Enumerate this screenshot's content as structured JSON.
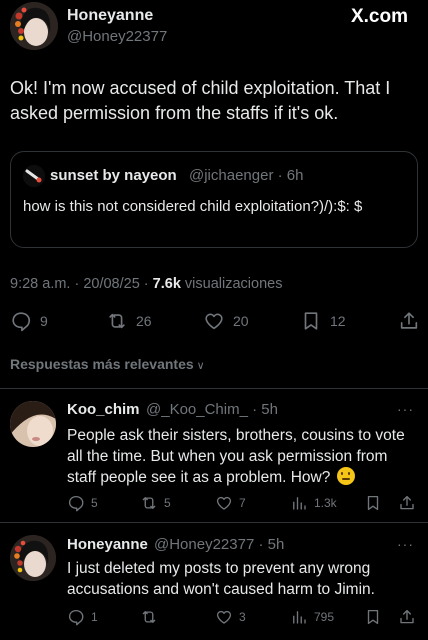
{
  "header": {
    "author_name": "Honeyanne",
    "author_handle": "@Honey22377",
    "watermark": "X.com"
  },
  "post": {
    "text": "Ok! I'm now accused of child exploitation. That I asked permission from the staffs if it's ok.",
    "quote": {
      "name": "sunset by nayeon",
      "handle_time": "@jichaenger · 6h",
      "text": "how is this not considered child exploitation?)/):$: $"
    },
    "time": "9:28 a.m. · 20/08/25 · ",
    "views_count": "7.6k",
    "views_label": " visualizaciones",
    "stats": {
      "replies": "9",
      "reposts": "26",
      "likes": "20",
      "bookmarks": "12"
    }
  },
  "sort_label": "Respuestas más relevantes",
  "replies": [
    {
      "name": "Koo_chim",
      "handle_time": "@_Koo_Chim_ · 5h",
      "text": "People ask their sisters, brothers, cousins to vote all the time. But when you ask permission from staff people see it as a problem. How?",
      "emoji": "slightly-frowning-face",
      "stats": {
        "replies": "5",
        "reposts": "5",
        "likes": "7",
        "views": "1.3k"
      }
    },
    {
      "name": "Honeyanne",
      "handle_time": "@Honey22377 · 5h",
      "text": "I just deleted my posts to prevent any wrong accusations and won't caused harm to Jimin.",
      "stats": {
        "replies": "1",
        "reposts": "",
        "likes": "3",
        "views": "795"
      }
    }
  ]
}
